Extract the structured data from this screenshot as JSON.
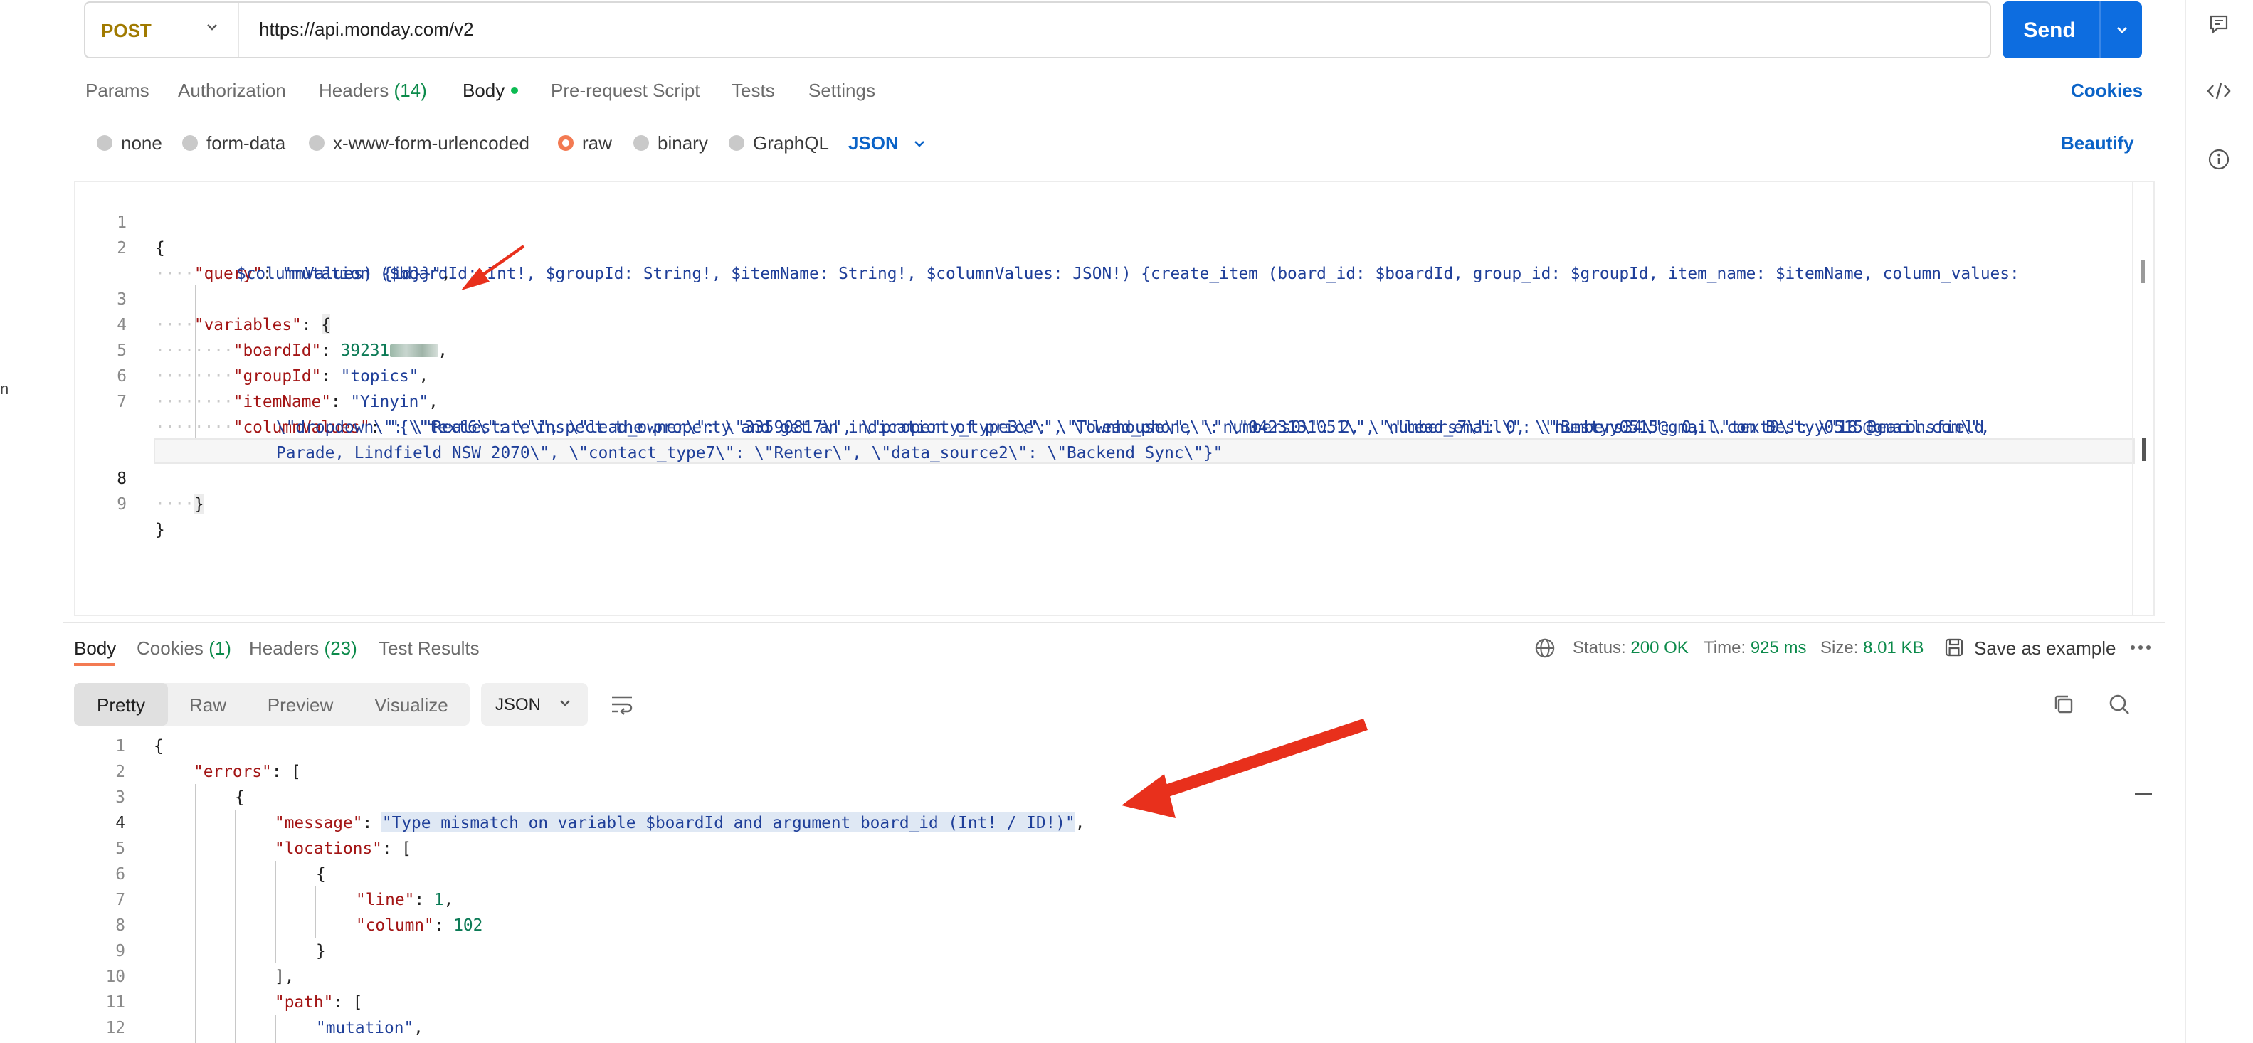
{
  "request": {
    "method": "POST",
    "url": "https://api.monday.com/v2",
    "send_label": "Send",
    "tabs": [
      {
        "label": "Params"
      },
      {
        "label": "Authorization"
      },
      {
        "label": "Headers",
        "count": "(14)"
      },
      {
        "label": "Body"
      },
      {
        "label": "Pre-request Script"
      },
      {
        "label": "Tests"
      },
      {
        "label": "Settings"
      }
    ],
    "cookies_label": "Cookies",
    "body_types": [
      "none",
      "form-data",
      "x-www-form-urlencoded",
      "raw",
      "binary",
      "GraphQL"
    ],
    "selected_body_type": "raw",
    "format": "JSON",
    "beautify_label": "Beautify"
  },
  "editor": {
    "line_numbers": [
      "1",
      "2",
      "",
      "3",
      "4",
      "5",
      "6",
      "7",
      "",
      "",
      "8",
      "9"
    ],
    "lines": {
      "l1": "{",
      "l2_key": "\"query\"",
      "l2_val_a": "\"mutation ($boardId: Int!, $groupId: String!, $itemName: String!, $columnValues: JSON!) {create_item (board_id: $boardId, group_id: $groupId, item_name: $itemName, column_values:",
      "l2_val_b": "$columnValues) {id}}\"",
      "l3_key": "\"variables\"",
      "l3_rest": "{",
      "l4_key": "\"boardId\"",
      "l4_val": "39231",
      "l5_key": "\"groupId\"",
      "l5_val": "\"topics\"",
      "l6_key": "\"itemName\"",
      "l6_val": "\"Yinyin\"",
      "l7_key": "\"columnValues\"",
      "l7_val_a": "\"{\\\"text6\\\": \\\"inspect the property and get an indication of price\\\", \\\"lead_phone\\\": \\\"0423131051\\\", \\\"lead_email\\\": \\\"Bestyy0515@gmail.com Bestyy0515@gmail.com\\\",",
      "l7_val_b": "\\\"dropdown\\\": \\\"Realestate\\\", \\\"lead_owner\\\": \\\"33590817\\\", \\\"property_type3\\\": \\\"Townhouse\\\", \\\"numbers0\\\": 2, \\\"numbers7\\\": 0, \\\"numbers34\\\": 0, \\\"text0\\\": \\\"18 Beaconsfield",
      "l7_val_c": "Parade, Lindfield NSW 2070\\\", \\\"contact_type7\\\": \\\"Renter\\\", \\\"data_source2\\\": \\\"Backend Sync\\\"}\"",
      "l8": "}",
      "l9": "}"
    }
  },
  "response": {
    "tabs": [
      {
        "label": "Body"
      },
      {
        "label": "Cookies",
        "count": "(1)"
      },
      {
        "label": "Headers",
        "count": "(23)"
      },
      {
        "label": "Test Results"
      }
    ],
    "status_label": "Status:",
    "status_value": "200 OK",
    "time_label": "Time:",
    "time_value": "925 ms",
    "size_label": "Size:",
    "size_value": "8.01 KB",
    "save_example_label": "Save as example",
    "views": [
      "Pretty",
      "Raw",
      "Preview",
      "Visualize"
    ],
    "active_view": "Pretty",
    "format": "JSON",
    "line_numbers": [
      "1",
      "2",
      "3",
      "4",
      "5",
      "6",
      "7",
      "8",
      "9",
      "10",
      "11",
      "12"
    ],
    "lines": {
      "r1": "{",
      "r2_key": "\"errors\"",
      "r2_rest": ": [",
      "r3": "{",
      "r4_key": "\"message\"",
      "r4_val": "\"Type mismatch on variable $boardId and argument board_id (Int! / ID!)\"",
      "r5_key": "\"locations\"",
      "r5_rest": ": [",
      "r6": "{",
      "r7_key": "\"line\"",
      "r7_val": "1",
      "r8_key": "\"column\"",
      "r8_val": "102",
      "r9": "}",
      "r10": "],",
      "r11_key": "\"path\"",
      "r11_rest": ": [",
      "r12_val": "\"mutation\""
    }
  },
  "left_panel": {
    "fragment": "n"
  },
  "colors": {
    "send": "#0d6de0",
    "accent": "#f37a52",
    "link": "#0b63c7",
    "status_ok": "#0b8a4a",
    "annotation_arrow": "#e8301c"
  }
}
